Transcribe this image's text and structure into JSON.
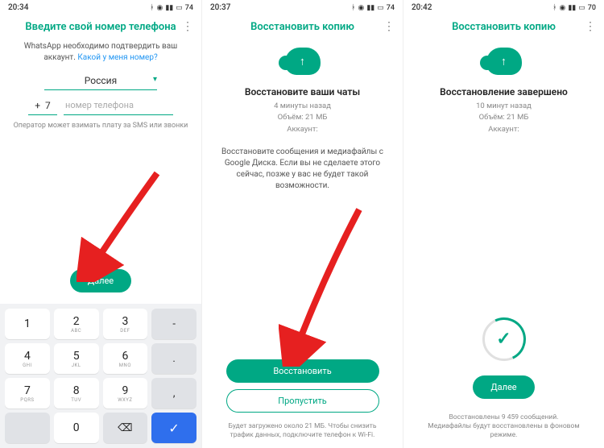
{
  "screen1": {
    "time": "20:34",
    "battery": "74",
    "title": "Введите свой номер телефона",
    "desc_pre": "WhatsApp необходимо подтвердить ваш аккаунт. ",
    "desc_link": "Какой у меня номер?",
    "country": "Россия",
    "cc_prefix": "+",
    "cc": "7",
    "phone_placeholder": "номер телефона",
    "hint": "Оператор может взимать плату за SMS или звонки",
    "next": "Далее",
    "keys": {
      "k1": "1",
      "k2": "2",
      "k2l": "ABC",
      "k3": "3",
      "k3l": "DEF",
      "k4": "4",
      "k4l": "GHI",
      "k5": "5",
      "k5l": "JKL",
      "k6": "6",
      "k6l": "MNO",
      "k7": "7",
      "k7l": "PQRS",
      "k8": "8",
      "k8l": "TUV",
      "k9": "9",
      "k9l": "WXYZ",
      "k0": "0",
      "dash": "-",
      "dot": ".",
      "comma": ",",
      "back": "⌫",
      "ok": "✓"
    }
  },
  "screen2": {
    "time": "20:37",
    "battery": "74",
    "title": "Восстановить копию",
    "subtitle": "Восстановите ваши чаты",
    "meta_time": "4 минуты назад",
    "meta_size": "Объём: 21 МБ",
    "meta_acc": "Аккаунт:",
    "body": "Восстановите сообщения и медиафайлы с Google Диска. Если вы не сделаете этого сейчас, позже у вас не будет такой возможности.",
    "restore": "Восстановить",
    "skip": "Пропустить",
    "foot": "Будет загружено около 21 МБ. Чтобы снизить трафик данных, подключите телефон к Wi-Fi."
  },
  "screen3": {
    "time": "20:42",
    "battery": "70",
    "title": "Восстановить копию",
    "subtitle": "Восстановление завершено",
    "meta_time": "10 минут назад",
    "meta_size": "Объём: 21 МБ",
    "meta_acc": "Аккаунт:",
    "next": "Далее",
    "foot": "Восстановлены 9 459 сообщений. Медиафайлы будут восстановлены в фоновом режиме."
  }
}
